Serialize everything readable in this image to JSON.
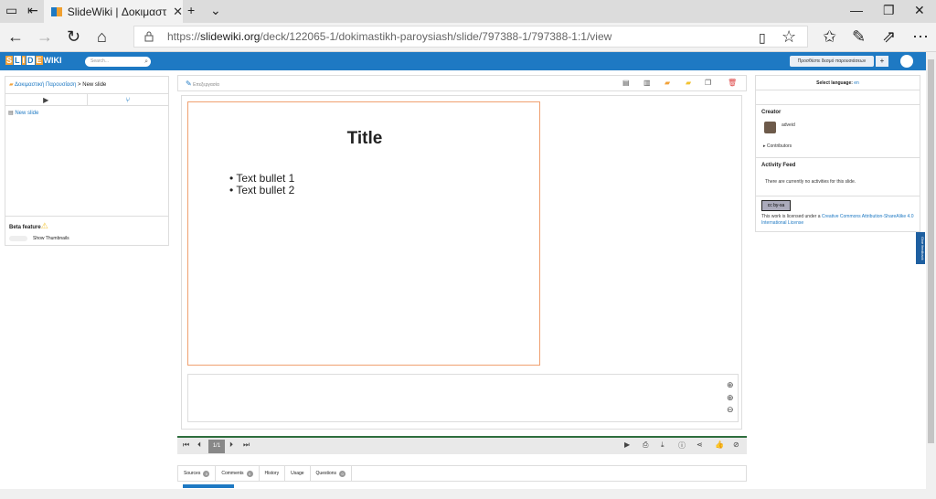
{
  "browser": {
    "tab_title": "SlideWiki | Δοκιμαστική",
    "tab_close": "✕",
    "url_prefix": "https://",
    "url_host": "slidewiki.org",
    "url_path": "/deck/122065-1/dokimastikh-paroysiash/slide/797388-1/797388-1:1/view"
  },
  "app": {
    "logo_letters": [
      "S",
      "L",
      "I",
      "D",
      "E",
      "WIKI"
    ],
    "search_placeholder": "Search...",
    "add_presentation": "Προσθέστε δεσμό παρουσιάσεων",
    "add_plus": "+"
  },
  "left": {
    "breadcrumb_deck": "Δοκιμαστική Παρουσίαση",
    "breadcrumb_sep": ">",
    "breadcrumb_current": "New slide",
    "tree_item": "New slide",
    "beta_label": "Beta feature",
    "thumbnails_label": "Show Thumbnails"
  },
  "center": {
    "edit_label": "Επεξεργασία",
    "slide_title": "Title",
    "bullets": [
      "• Text bullet 1",
      "• Text bullet 2"
    ],
    "slide_counter": "1/1",
    "tabs": [
      {
        "label": "Sources",
        "badge": "0"
      },
      {
        "label": "Comments",
        "badge": "0"
      },
      {
        "label": "History"
      },
      {
        "label": "Usage"
      },
      {
        "label": "Questions",
        "badge": "0"
      }
    ]
  },
  "right": {
    "select_language_label": "Select language:",
    "select_language_value": "en",
    "creator_heading": "Creator",
    "creator_name": "adveid",
    "contributors": "Contributors",
    "activity_heading": "Activity Feed",
    "activity_text": "There are currently no activities for this slide.",
    "cc_badge": "cc by-sa",
    "license_prefix": "This work is licensed under a ",
    "license_link": "Creative Commons Attribution-ShareAlike 4.0 International License",
    "feedback": "Give feedback"
  },
  "colors": {
    "brand": "#1e79c3",
    "accent": "#f2a23a",
    "slide_border": "#f0a070"
  }
}
